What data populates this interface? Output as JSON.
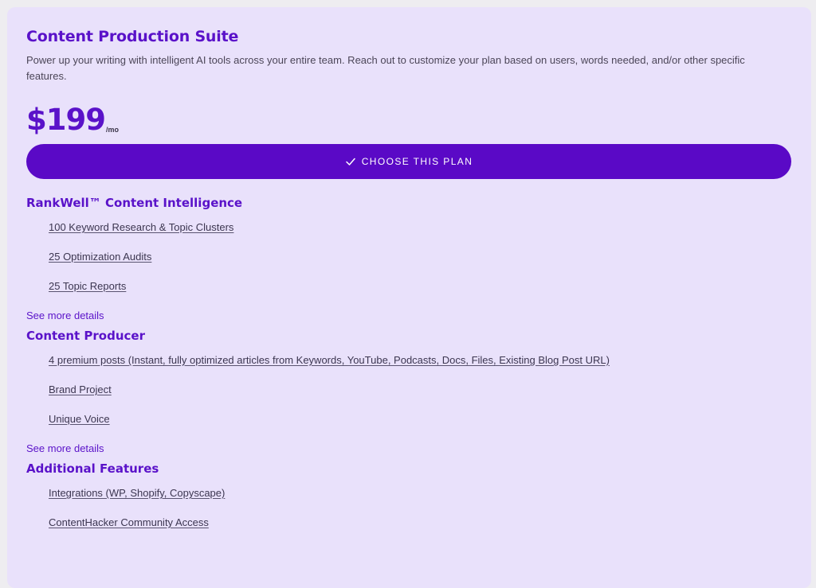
{
  "plan": {
    "title": "Content Production Suite",
    "description": "Power up your writing with intelligent AI tools across your entire team. Reach out to customize your plan based on users, words needed, and/or other specific features.",
    "price": "$199",
    "period": "/mo",
    "cta_label": "CHOOSE THIS PLAN",
    "cta_icon": "check-icon"
  },
  "sections": [
    {
      "title": "RankWell™ Content Intelligence",
      "items": [
        "100 Keyword Research & Topic Clusters",
        "25 Optimization Audits",
        "25 Topic Reports"
      ],
      "more_label": "See more details"
    },
    {
      "title": "Content Producer",
      "items": [
        "4 premium posts (Instant, fully optimized articles from Keywords, YouTube, Podcasts, Docs, Files, Existing Blog Post URL)",
        "Brand Project",
        "Unique Voice"
      ],
      "more_label": "See more details"
    },
    {
      "title": "Additional Features",
      "items": [
        "Integrations (WP, Shopify, Copyscape)",
        "ContentHacker Community Access"
      ]
    }
  ],
  "colors": {
    "accent": "#5a12c9",
    "button": "#5a09c6",
    "card_bg": "#e9e1fb",
    "page_bg": "#eeedf0"
  }
}
